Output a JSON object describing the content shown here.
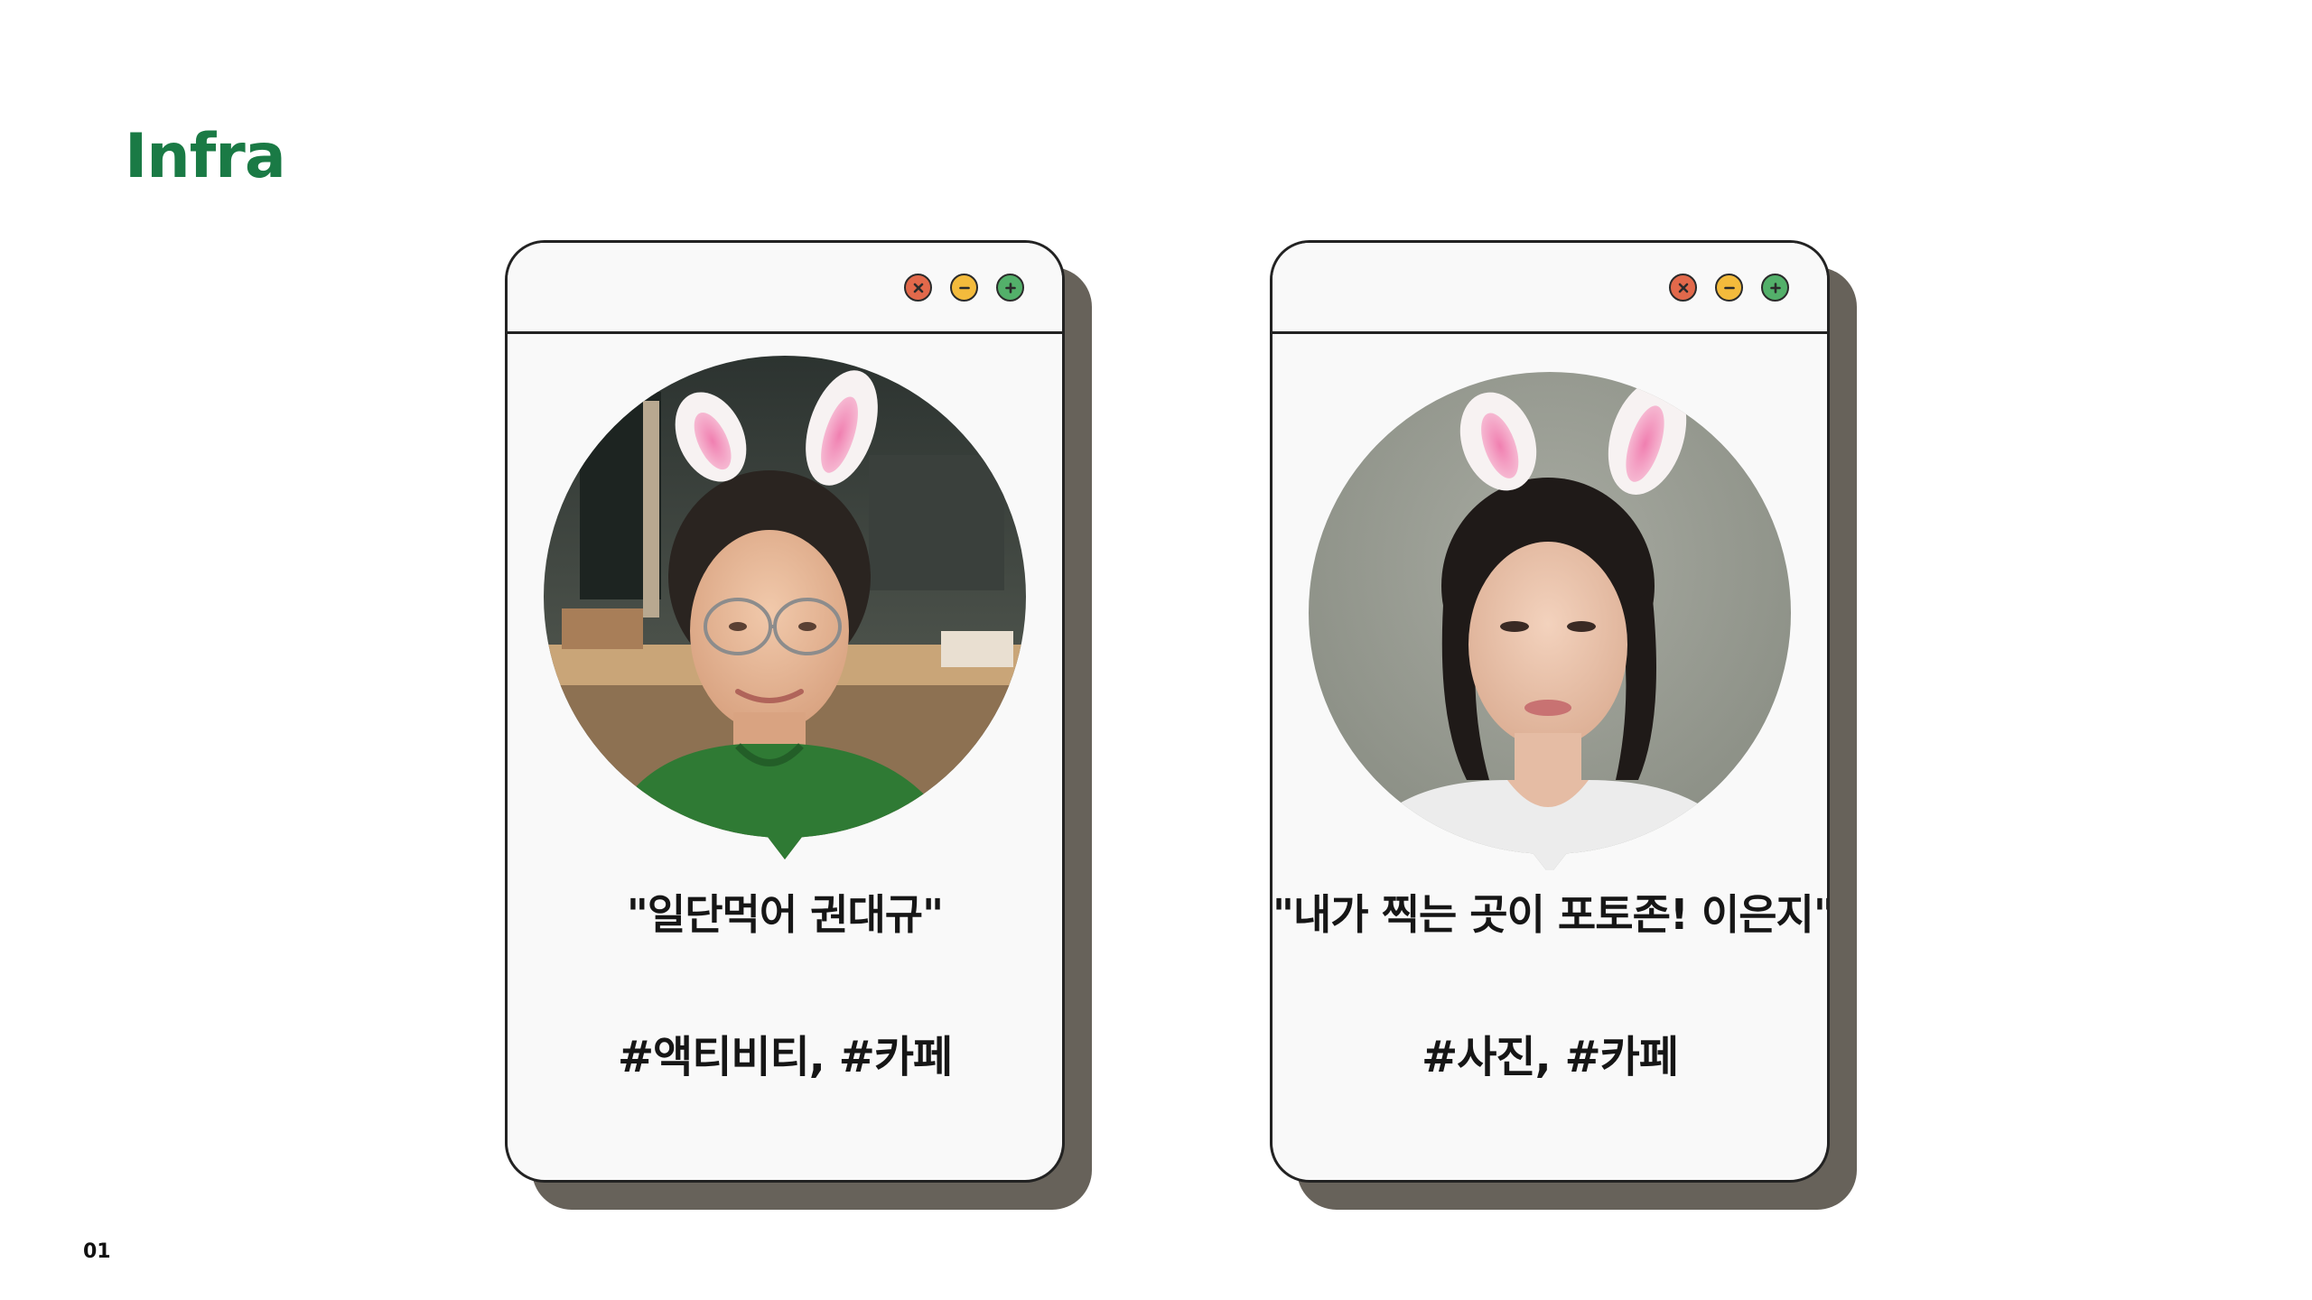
{
  "page": {
    "title": "Infra",
    "number": "01"
  },
  "colors": {
    "accent": "#1a7a45",
    "card_background": "#f9f9f9",
    "card_shadow": "#67625a",
    "close_button": "#e2694b",
    "minimize_button": "#f4bb3c",
    "maximize_button": "#53b06a"
  },
  "icons": {
    "close": "close-icon",
    "minimize": "minimize-icon",
    "maximize": "maximize-icon"
  },
  "profiles": [
    {
      "quote": "\"일단먹어 권대규\"",
      "tags": "#액티비티, #카페",
      "photo": "man with glasses and bunny-ear filter in a room"
    },
    {
      "quote": "\"내가 찍는 곳이 포토존! 이은지\"",
      "tags": "#사진, #카페",
      "photo": "woman with bunny-ear filter against a gray wall"
    }
  ]
}
